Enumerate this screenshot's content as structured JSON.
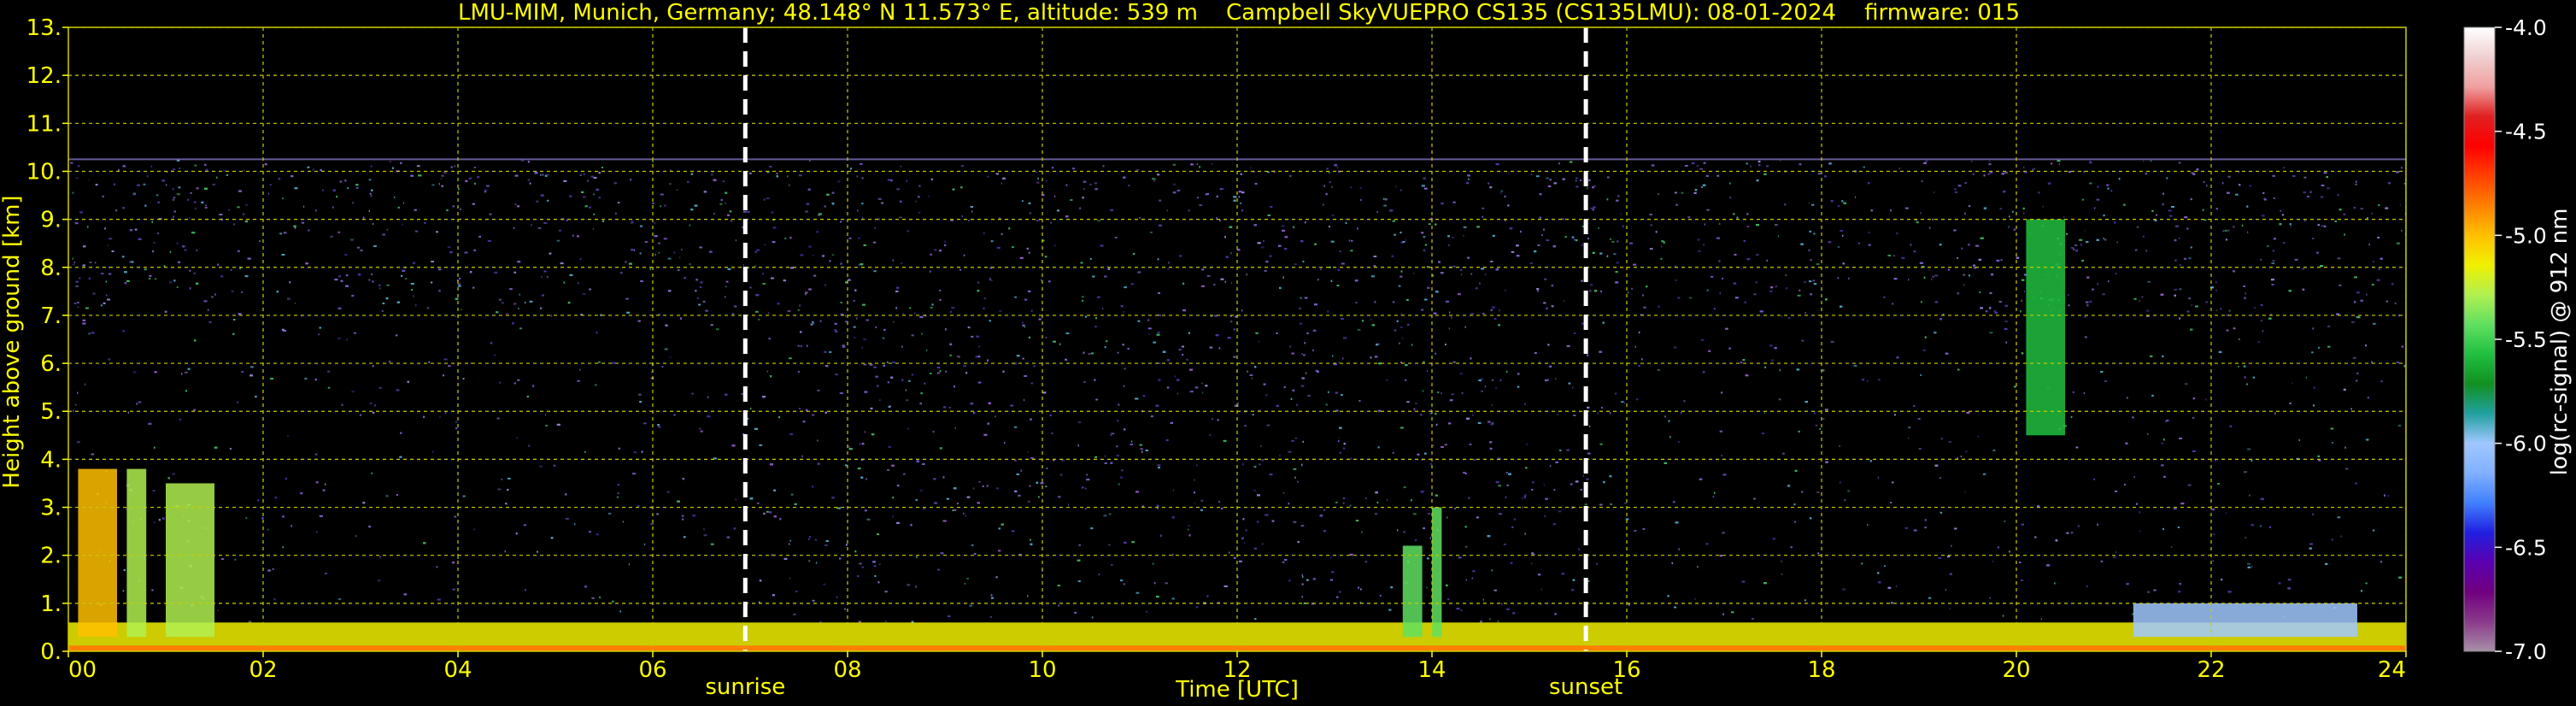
{
  "title": "LMU-MIM, Munich, Germany; 48.148° N 11.573° E, altitude: 539 m    Campbell SkyVUEPRO CS135 (CS135LMU): 08-01-2024    firmware: 015",
  "colors": {
    "text": "#ffff00",
    "grid": "#cccc00",
    "background": "#000000",
    "event_line": "#ffffff",
    "colorbar_label": "#ffffff"
  },
  "chart_data": [
    {
      "type": "heatmap",
      "title": "LMU-MIM, Munich, Germany; 48.148° N 11.573° E, altitude: 539 m    Campbell SkyVUEPRO CS135 (CS135LMU): 08-01-2024    firmware: 015",
      "xlabel": "Time [UTC]",
      "ylabel": "Height above ground [km]",
      "xlim": [
        0,
        24
      ],
      "ylim": [
        0,
        13
      ],
      "x_ticks": [
        0,
        2,
        4,
        6,
        8,
        10,
        12,
        14,
        16,
        18,
        20,
        22,
        24
      ],
      "x_tick_labels": [
        "00",
        "02",
        "04",
        "06",
        "08",
        "10",
        "12",
        "14",
        "16",
        "18",
        "20",
        "22",
        "24"
      ],
      "y_ticks": [
        0,
        1,
        2,
        3,
        4,
        5,
        6,
        7,
        8,
        9,
        10,
        11,
        12,
        13
      ],
      "y_tick_labels": [
        "0.",
        "1.",
        "2.",
        "3.",
        "4.",
        "5.",
        "6.",
        "7.",
        "8.",
        "9.",
        "10.",
        "11.",
        "12.",
        "13."
      ],
      "grid": true,
      "signal_top_km": 10.25,
      "events": [
        {
          "label": "sunrise",
          "time": 6.95
        },
        {
          "label": "sunset",
          "time": 15.58
        }
      ],
      "colorbar": {
        "label": "log(rc-signal) @ 912 nm",
        "range": [
          -7.0,
          -4.0
        ],
        "ticks": [
          -4.0,
          -4.5,
          -5.0,
          -5.5,
          -6.0,
          -6.5,
          -7.0
        ],
        "tick_labels": [
          "-4.0",
          "-4.5",
          "-5.0",
          "-5.5",
          "-6.0",
          "-6.5",
          "-7.0"
        ],
        "stops": [
          "#a890a8",
          "#8a3a8a",
          "#700080",
          "#5a00b0",
          "#2020e0",
          "#4080ff",
          "#80b0ff",
          "#a0c8ff",
          "#20a0a0",
          "#109020",
          "#20c040",
          "#60e060",
          "#b0f050",
          "#f0f000",
          "#ffc000",
          "#ff8000",
          "#ff4000",
          "#ff0000",
          "#e02020",
          "#f0a0a0",
          "#f0d0d0",
          "#ffffff"
        ]
      },
      "features": [
        {
          "name": "surface aerosol layer",
          "time_range": [
            0,
            24
          ],
          "top_km": 0.6,
          "level": -5.2
        },
        {
          "name": "low cloud column",
          "time_range": [
            0.1,
            0.5
          ],
          "height_range_km": [
            0.3,
            3.8
          ],
          "level": -5.0
        },
        {
          "name": "low cloud column",
          "time_range": [
            0.6,
            0.8
          ],
          "height_range_km": [
            0.3,
            3.8
          ],
          "level": -5.3
        },
        {
          "name": "low cloud column",
          "time_range": [
            1.0,
            1.5
          ],
          "height_range_km": [
            0.3,
            3.5
          ],
          "level": -5.3
        },
        {
          "name": "elevated aerosol",
          "time_range": [
            21.2,
            23.5
          ],
          "height_range_km": [
            0.3,
            1.0
          ],
          "level": -6.0
        },
        {
          "name": "mid-level cloud",
          "time_range": [
            20.1,
            20.5
          ],
          "height_range_km": [
            4.5,
            9.0
          ],
          "level": -5.6
        },
        {
          "name": "convective plume",
          "time_range": [
            13.7,
            13.9
          ],
          "height_range_km": [
            0.3,
            2.2
          ],
          "level": -5.5
        },
        {
          "name": "convective plume",
          "time_range": [
            14.0,
            14.1
          ],
          "height_range_km": [
            0.3,
            3.0
          ],
          "level": -5.5
        }
      ]
    }
  ]
}
